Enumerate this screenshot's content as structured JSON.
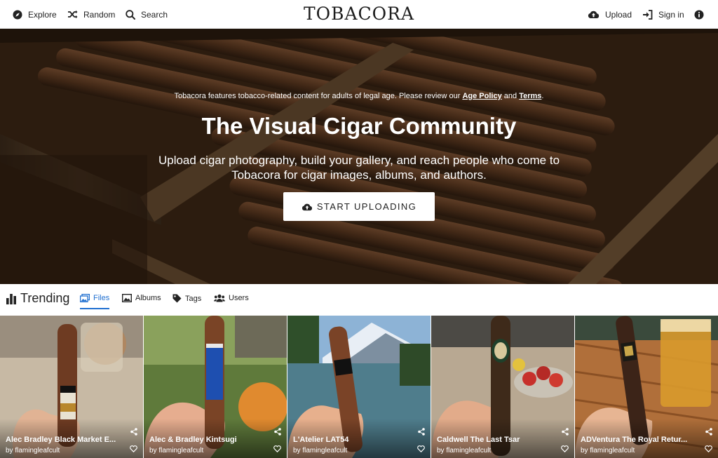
{
  "nav": {
    "explore": "Explore",
    "random": "Random",
    "search": "Search",
    "logo": "TOBACORA",
    "upload": "Upload",
    "signin": "Sign in"
  },
  "hero": {
    "notice_prefix": "Tobacora features tobacco-related content for adults of legal age. Please review our",
    "age_policy": "Age Policy",
    "and": "and",
    "terms": "Terms",
    "period": ".",
    "title": "The Visual Cigar Community",
    "subtitle_line1": "Upload cigar photography, build your gallery, and reach people who come to",
    "subtitle_line2": "Tobacora for cigar images, albums, and authors.",
    "cta": "START UPLOADING"
  },
  "tabs": {
    "heading": "Trending",
    "files": "Files",
    "albums": "Albums",
    "tags": "Tags",
    "users": "Users",
    "active": "files"
  },
  "cards": [
    {
      "title": "Alec Bradley Black Market E...",
      "author": "by flamingleafcult"
    },
    {
      "title": "Alec & Bradley Kintsugi",
      "author": "by flamingleafcult"
    },
    {
      "title": "L'Atelier LAT54",
      "author": "by flamingleafcult"
    },
    {
      "title": "Caldwell The Last Tsar",
      "author": "by flamingleafcult"
    },
    {
      "title": "ADVentura The Royal Retur...",
      "author": "by flamingleafcult"
    }
  ],
  "icons": {
    "explore": "compass-icon",
    "random": "shuffle-icon",
    "search": "search-icon",
    "upload": "cloud-upload-icon",
    "signin": "sign-in-icon",
    "about": "info-icon",
    "trending": "bar-chart-icon",
    "files": "images-icon",
    "albums": "album-icon",
    "tags": "tag-icon",
    "users": "users-icon",
    "share": "share-icon",
    "like": "heart-icon"
  },
  "colors": {
    "accent": "#1f6fd0",
    "hero_wood": "#5a3a22"
  }
}
